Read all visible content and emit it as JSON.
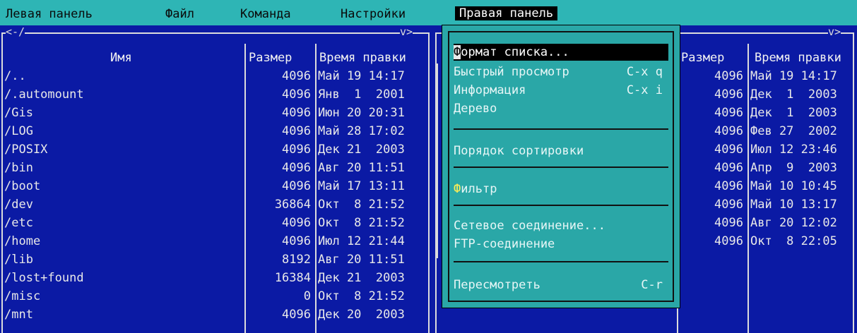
{
  "menubar": {
    "items": [
      {
        "label": "Левая панель"
      },
      {
        "label": "Файл"
      },
      {
        "label": "Команда"
      },
      {
        "label": "Настройки"
      },
      {
        "label": "Правая панель"
      }
    ]
  },
  "left_panel": {
    "path_label": "<-/",
    "corner_label": "v>",
    "columns": {
      "name": "Имя",
      "size": "Размер",
      "mtime": "Время правки"
    },
    "rows": [
      {
        "name": "/..",
        "size": "4096",
        "mtime": "Май 19 14:17"
      },
      {
        "name": "/.automount",
        "size": "4096",
        "mtime": "Янв  1  2001"
      },
      {
        "name": "/Gis",
        "size": "4096",
        "mtime": "Июн 20 20:31"
      },
      {
        "name": "/LOG",
        "size": "4096",
        "mtime": "Май 28 17:02"
      },
      {
        "name": "/POSIX",
        "size": "4096",
        "mtime": "Дек 21  2003"
      },
      {
        "name": "/bin",
        "size": "4096",
        "mtime": "Авг 20 11:51"
      },
      {
        "name": "/boot",
        "size": "4096",
        "mtime": "Май 17 13:11"
      },
      {
        "name": "/dev",
        "size": "36864",
        "mtime": "Окт  8 21:52"
      },
      {
        "name": "/etc",
        "size": "4096",
        "mtime": "Окт  8 21:52"
      },
      {
        "name": "/home",
        "size": "4096",
        "mtime": "Июл 12 21:44"
      },
      {
        "name": "/lib",
        "size": "8192",
        "mtime": "Авг 20 11:51"
      },
      {
        "name": "/lost+found",
        "size": "16384",
        "mtime": "Дек 21  2003"
      },
      {
        "name": "/misc",
        "size": "0",
        "mtime": "Окт  8 21:52"
      },
      {
        "name": "/mnt",
        "size": "4096",
        "mtime": "Дек 20  2003"
      }
    ]
  },
  "right_panel": {
    "corner_label": "v>",
    "columns": {
      "size": "Размер",
      "mtime": "Время правки"
    },
    "rows": [
      {
        "size": "4096",
        "mtime": "Май 19 14:17"
      },
      {
        "size": "4096",
        "mtime": "Дек  1  2003"
      },
      {
        "size": "4096",
        "mtime": "Дек  1  2003"
      },
      {
        "size": "4096",
        "mtime": "Фев 27  2002"
      },
      {
        "size": "4096",
        "mtime": "Июл 12 23:46"
      },
      {
        "size": "4096",
        "mtime": "Апр  9  2003"
      },
      {
        "size": "4096",
        "mtime": "Май 10 10:45"
      },
      {
        "size": "4096",
        "mtime": "Май 10 13:17"
      },
      {
        "size": "4096",
        "mtime": "Авг 20 12:02"
      },
      {
        "size": "4096",
        "mtime": "Окт  8 22:05"
      }
    ]
  },
  "dropdown": {
    "items": [
      {
        "hot": "Ф",
        "rest": "ормат списка...",
        "key": ""
      },
      {
        "hot": "",
        "rest": "Быстрый просмотр",
        "key": "C-x q"
      },
      {
        "hot": "",
        "rest": "Информация",
        "key": "C-x i"
      },
      {
        "hot": "",
        "rest": "Дерево",
        "key": ""
      },
      {
        "hot": "",
        "rest": "Порядок сортировки",
        "key": ""
      },
      {
        "hot": "Ф",
        "rest": "ильтр",
        "key": ""
      },
      {
        "hot": "",
        "rest": "Сетевое соединение...",
        "key": ""
      },
      {
        "hot": "",
        "rest": "FTP-соединение",
        "key": ""
      },
      {
        "hot": "",
        "rest": "Пересмотреть",
        "key": "C-r"
      }
    ]
  },
  "colors": {
    "background": "#0b1aa4",
    "menubar": "#2eb5b5",
    "dropdown": "#2aa7a7",
    "hotkey": "#ffee55"
  }
}
